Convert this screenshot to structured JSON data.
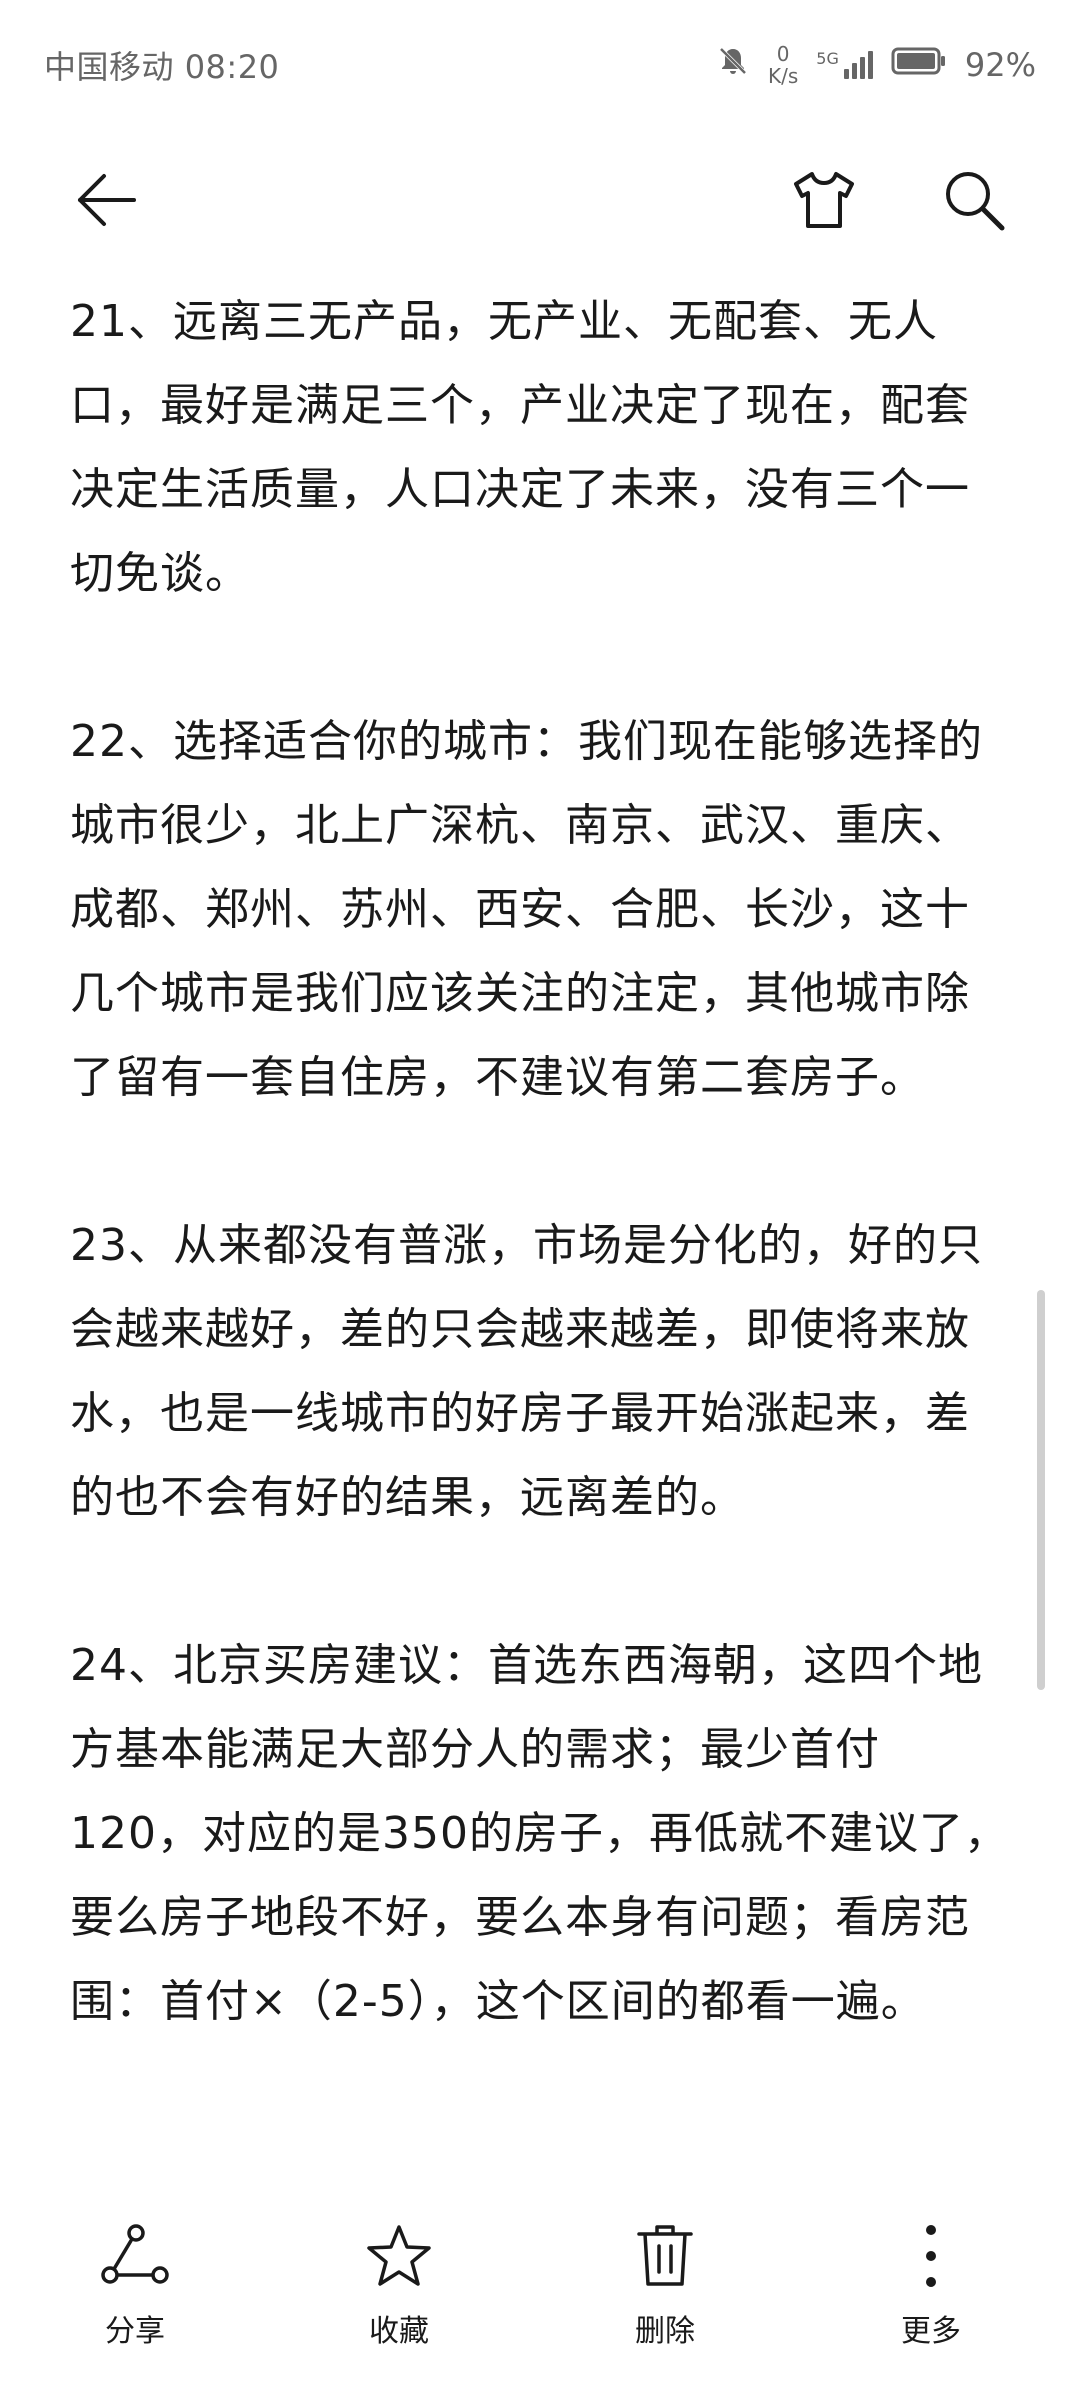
{
  "status_bar": {
    "carrier": "中国移动",
    "time": "08:20",
    "net_speed_value": "0",
    "net_speed_unit": "K/s",
    "network_type": "5G",
    "battery_percent": "92%"
  },
  "app_bar": {
    "back_icon": "arrow-left-icon",
    "theme_icon": "t-shirt-icon",
    "search_icon": "search-icon"
  },
  "content": {
    "paragraphs": [
      "21、远离三无产品，无产业、无配套、无人口，最好是满足三个，产业决定了现在，配套决定生活质量，人口决定了未来，没有三个一切免谈。",
      "22、选择适合你的城市：我们现在能够选择的城市很少，北上广深杭、南京、武汉、重庆、成都、郑州、苏州、西安、合肥、长沙，这十几个城市是我们应该关注的注定，其他城市除了留有一套自住房，不建议有第二套房子。",
      "23、从来都没有普涨，市场是分化的，好的只会越来越好，差的只会越来越差，即使将来放水，也是一线城市的好房子最开始涨起来，差的也不会有好的结果，远离差的。",
      "24、北京买房建议：首选东西海朝，这四个地方基本能满足大部分人的需求；最少首付120，对应的是350的房子，再低就不建议了，要么房子地段不好，要么本身有问题；看房范围：首付×（2-5），这个区间的都看一遍。"
    ]
  },
  "bottom_bar": {
    "share_label": "分享",
    "favorite_label": "收藏",
    "delete_label": "删除",
    "more_label": "更多"
  },
  "colors": {
    "text": "#1a1a1a",
    "status_text": "#666666",
    "background": "#ffffff",
    "scrollbar": "#cfcfcf"
  }
}
